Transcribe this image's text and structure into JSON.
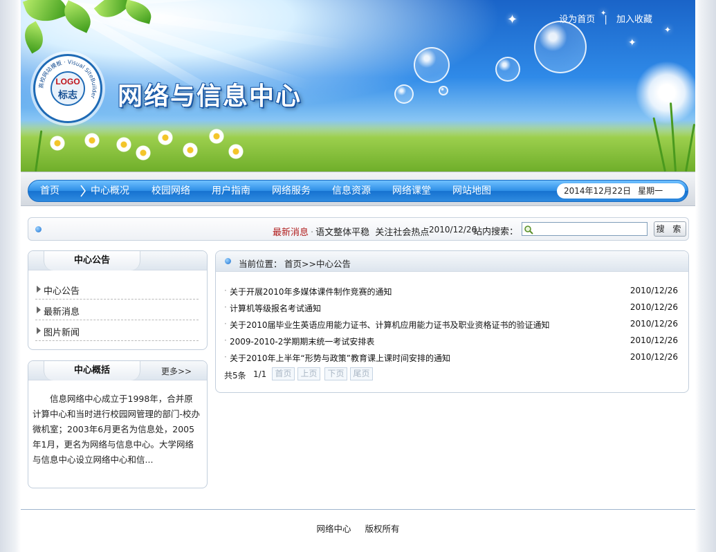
{
  "header": {
    "site_title": "网络与信息中心",
    "logo_text_top": "LOGO",
    "logo_text_bottom": "标志",
    "logo_ring_text": "高校网站模板 · Visual SiteBuilder",
    "top_links": [
      "设为首页",
      "加入收藏"
    ],
    "top_link_separator": "|"
  },
  "nav": {
    "items": [
      "首页",
      "中心概况",
      "校园网络",
      "用户指南",
      "网络服务",
      "信息资源",
      "网络课堂",
      "网站地图"
    ],
    "date": "2014年12月22日",
    "weekday": "星期一"
  },
  "news_bar": {
    "label": "最新消息",
    "items": [
      "语文整体平稳",
      "关注社会热点"
    ],
    "date": "2010/12/26",
    "search_label": "站内搜索：",
    "search_value": "",
    "search_button": "搜 索"
  },
  "sidebar": {
    "notice": {
      "title": "中心公告",
      "items": [
        "中心公告",
        "最新消息",
        "图片新闻"
      ]
    },
    "intro": {
      "title": "中心概括",
      "more": "更多>>",
      "text": "信息网络中心成立于1998年，合并原计算中心和当时进行校园网管理的部门-校办微机室；2003年6月更名为信息处，2005年1月，更名为网络与信息中心。大学网络与信息中心设立网络中心和信..."
    }
  },
  "main": {
    "breadcrumb_label": "当前位置：",
    "breadcrumb_path": "首页>>中心公告",
    "articles": [
      {
        "title": "关于开展2010年多媒体课件制作竞赛的通知",
        "date": "2010/12/26"
      },
      {
        "title": "计算机等级报名考试通知",
        "date": "2010/12/26"
      },
      {
        "title": "关于2010届毕业生英语应用能力证书、计算机应用能力证书及职业资格证书的验证通知",
        "date": "2010/12/26"
      },
      {
        "title": "2009-2010-2学期期末统一考试安排表",
        "date": "2010/12/26"
      },
      {
        "title": "关于2010年上半年“形势与政策”教育课上课时间安排的通知",
        "date": "2010/12/26"
      }
    ],
    "pager": {
      "total": "共5条",
      "page": "1/1",
      "buttons": [
        "首页",
        "上页",
        "下页",
        "尾页"
      ]
    }
  },
  "footer": {
    "items": [
      "网络中心",
      "版权所有"
    ]
  }
}
